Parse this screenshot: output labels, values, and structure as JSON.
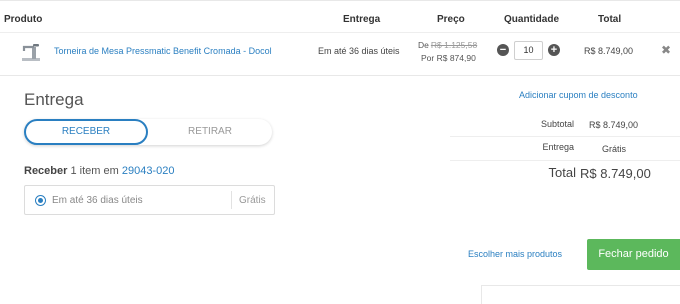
{
  "cart": {
    "headers": {
      "produto": "Produto",
      "entrega": "Entrega",
      "preco": "Preço",
      "quantidade": "Quantidade",
      "total": "Total"
    },
    "item": {
      "name": "Torneira de Mesa Pressmatic Benefit Cromada - Docol",
      "shipping_estimate": "Em até 36 dias úteis",
      "price_from_label": "De",
      "price_from": "R$ 1.125,58",
      "price_to": "Por R$ 874,90",
      "quantity": "10",
      "total": "R$ 8.749,00",
      "remove_glyph": "✖",
      "minus_glyph": "−",
      "plus_glyph": "+"
    }
  },
  "shipping": {
    "title": "Entrega",
    "tabs": [
      "RECEBER",
      "RETIRAR"
    ],
    "receive_label": "Receber",
    "receive_text": "1 item em",
    "zip": "29043-020",
    "option": {
      "label": "Em até 36 dias úteis",
      "price": "Grátis"
    }
  },
  "summary": {
    "coupon_link": "Adicionar cupom de desconto",
    "subtotal_label": "Subtotal",
    "subtotal_value": "R$ 8.749,00",
    "shipping_label": "Entrega",
    "shipping_value": "Grátis",
    "total_label": "Total",
    "total_value": "R$ 8.749,00"
  },
  "actions": {
    "more_products": "Escolher mais produtos",
    "checkout": "Fechar pedido"
  },
  "colors": {
    "link": "#2a7fc1",
    "checkout": "#5cb85c"
  },
  "icons": {
    "product_thumbnail": "faucet-image",
    "remove": "close-icon",
    "radio": "radio-selected-icon"
  }
}
